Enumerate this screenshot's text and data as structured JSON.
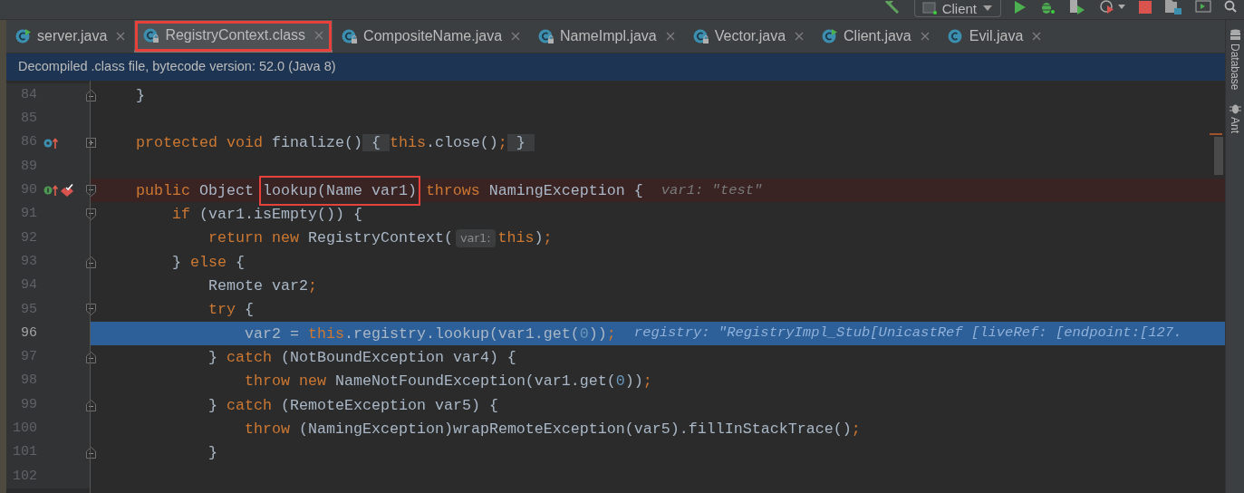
{
  "toolbar": {
    "run_config": "Client"
  },
  "tabs": [
    {
      "label": "server.java",
      "kind": "runnable",
      "selected": false,
      "highlighted": false
    },
    {
      "label": "RegistryContext.class",
      "kind": "library",
      "selected": true,
      "highlighted": true
    },
    {
      "label": "CompositeName.java",
      "kind": "library",
      "selected": false,
      "highlighted": false
    },
    {
      "label": "NameImpl.java",
      "kind": "library",
      "selected": false,
      "highlighted": false
    },
    {
      "label": "Vector.java",
      "kind": "library",
      "selected": false,
      "highlighted": false
    },
    {
      "label": "Client.java",
      "kind": "runnable",
      "selected": false,
      "highlighted": false
    },
    {
      "label": "Evil.java",
      "kind": "source",
      "selected": false,
      "highlighted": false
    }
  ],
  "banner": "Decompiled .class file, bytecode version: 52.0 (Java 8)",
  "lines": [
    {
      "number": "84",
      "folded": false,
      "fold_end": true,
      "breakpoint": false,
      "current": false,
      "segments": [
        {
          "kind": "code",
          "tokens": [
            {
              "kind": "plain",
              "text": "}"
            }
          ]
        }
      ]
    },
    {
      "number": "85",
      "folded": false,
      "fold_end": false,
      "breakpoint": false,
      "current": false
    },
    {
      "number": "86",
      "kind": "overriding",
      "folded": true,
      "fold_end": false,
      "breakpoint": false,
      "current": false,
      "segments": [
        {
          "kind": "code",
          "tokens": [
            {
              "kind": "keyword",
              "text": "protected void "
            },
            {
              "kind": "plain",
              "text": "finalize()"
            },
            {
              "kind": "folded",
              "text": "{"
            },
            {
              "kind": "keyword",
              "text": "this"
            },
            {
              "kind": "plain",
              "text": ".close()"
            },
            {
              "kind": "keyword",
              "text": ";"
            },
            {
              "kind": "folded",
              "text": "}"
            }
          ]
        }
      ]
    },
    {
      "number": "89",
      "folded": false,
      "fold_end": false,
      "breakpoint": false,
      "current": false
    },
    {
      "number": "90",
      "kind": "implementing",
      "folded": false,
      "fold_end": false,
      "breakpoint": true,
      "current": false,
      "segments": [
        {
          "kind": "code",
          "tokens": [
            {
              "kind": "keyword",
              "text": "public "
            },
            {
              "kind": "plain",
              "text": "Object"
            }
          ]
        },
        {
          "kind": "boxed",
          "tokens": [
            {
              "kind": "plain",
              "text": "lookup(Name var1)"
            }
          ]
        },
        {
          "kind": "code",
          "tokens": [
            {
              "kind": "keyword",
              "text": "throws "
            },
            {
              "kind": "plain",
              "text": "NamingException {"
            }
          ]
        },
        {
          "kind": "hint",
          "text": "var1: \"test\""
        }
      ],
      "children": [
        {
          "number": "91",
          "folded": false,
          "fold_end": false,
          "breakpoint": false,
          "current": false,
          "segments": [
            {
              "kind": "code",
              "tokens": [
                {
                  "kind": "keyword",
                  "text": "if "
                },
                {
                  "kind": "plain",
                  "text": "(var1.isEmpty()) {"
                }
              ]
            }
          ],
          "children": [
            {
              "number": "92",
              "folded": false,
              "fold_end": false,
              "breakpoint": false,
              "current": false,
              "segments": [
                {
                  "kind": "code",
                  "tokens": [
                    {
                      "kind": "keyword",
                      "text": "return new "
                    },
                    {
                      "kind": "plain",
                      "text": "RegistryContext("
                    }
                  ]
                },
                {
                  "kind": "inlay",
                  "text": "var1:"
                },
                {
                  "kind": "code",
                  "tokens": [
                    {
                      "kind": "keyword",
                      "text": "this"
                    },
                    {
                      "kind": "plain",
                      "text": ")"
                    },
                    {
                      "kind": "keyword",
                      "text": ";"
                    }
                  ]
                }
              ]
            }
          ]
        },
        {
          "number": "93",
          "folded": false,
          "fold_end": true,
          "breakpoint": false,
          "current": false,
          "segments": [
            {
              "kind": "code",
              "tokens": [
                {
                  "kind": "plain",
                  "text": "} "
                },
                {
                  "kind": "keyword",
                  "text": "else "
                },
                {
                  "kind": "plain",
                  "text": "{"
                }
              ]
            }
          ],
          "children": [
            {
              "number": "94",
              "folded": false,
              "fold_end": false,
              "breakpoint": false,
              "current": false,
              "segments": [
                {
                  "kind": "code",
                  "tokens": [
                    {
                      "kind": "plain",
                      "text": "Remote var2"
                    },
                    {
                      "kind": "keyword",
                      "text": ";"
                    }
                  ]
                }
              ]
            },
            {
              "number": "95",
              "folded": false,
              "fold_end": false,
              "breakpoint": false,
              "current": false,
              "segments": [
                {
                  "kind": "code",
                  "tokens": [
                    {
                      "kind": "keyword",
                      "text": "try "
                    },
                    {
                      "kind": "plain",
                      "text": "{"
                    }
                  ]
                }
              ],
              "children": [
                {
                  "number": "96",
                  "folded": false,
                  "fold_end": false,
                  "breakpoint": false,
                  "current": true,
                  "segments": [
                    {
                      "kind": "code",
                      "tokens": [
                        {
                          "kind": "plain",
                          "text": "var2 = "
                        },
                        {
                          "kind": "keyword",
                          "text": "this"
                        },
                        {
                          "kind": "plain",
                          "text": ".registry.lookup(var1.get("
                        },
                        {
                          "kind": "number",
                          "text": "0"
                        },
                        {
                          "kind": "plain",
                          "text": "))"
                        },
                        {
                          "kind": "keyword",
                          "text": ";"
                        }
                      ]
                    },
                    {
                      "kind": "hint",
                      "text": "registry: \"RegistryImpl_Stub[UnicastRef [liveRef: [endpoint:[127."
                    }
                  ]
                }
              ]
            },
            {
              "number": "97",
              "folded": false,
              "fold_end": true,
              "breakpoint": false,
              "current": false,
              "segments": [
                {
                  "kind": "code",
                  "tokens": [
                    {
                      "kind": "plain",
                      "text": "} "
                    },
                    {
                      "kind": "keyword",
                      "text": "catch "
                    },
                    {
                      "kind": "plain",
                      "text": "(NotBoundException var4) {"
                    }
                  ]
                }
              ],
              "children": [
                {
                  "number": "98",
                  "folded": false,
                  "fold_end": false,
                  "breakpoint": false,
                  "current": false,
                  "segments": [
                    {
                      "kind": "code",
                      "tokens": [
                        {
                          "kind": "keyword",
                          "text": "throw new "
                        },
                        {
                          "kind": "plain",
                          "text": "NameNotFoundException(var1.get("
                        },
                        {
                          "kind": "number",
                          "text": "0"
                        },
                        {
                          "kind": "plain",
                          "text": "))"
                        },
                        {
                          "kind": "keyword",
                          "text": ";"
                        }
                      ]
                    }
                  ]
                }
              ]
            },
            {
              "number": "99",
              "folded": false,
              "fold_end": true,
              "breakpoint": false,
              "current": false,
              "segments": [
                {
                  "kind": "code",
                  "tokens": [
                    {
                      "kind": "plain",
                      "text": "} "
                    },
                    {
                      "kind": "keyword",
                      "text": "catch "
                    },
                    {
                      "kind": "plain",
                      "text": "(RemoteException var5) {"
                    }
                  ]
                }
              ],
              "children": [
                {
                  "number": "100",
                  "folded": false,
                  "fold_end": false,
                  "breakpoint": false,
                  "current": false,
                  "segments": [
                    {
                      "kind": "code",
                      "tokens": [
                        {
                          "kind": "keyword",
                          "text": "throw "
                        },
                        {
                          "kind": "plain",
                          "text": "(NamingException)wrapRemoteException(var5).fillInStackTrace()"
                        },
                        {
                          "kind": "keyword",
                          "text": ";"
                        }
                      ]
                    }
                  ]
                }
              ]
            },
            {
              "number": "101",
              "folded": false,
              "fold_end": true,
              "breakpoint": false,
              "current": false,
              "segments": [
                {
                  "kind": "code",
                  "tokens": [
                    {
                      "kind": "plain",
                      "text": "}"
                    }
                  ]
                }
              ]
            }
          ]
        }
      ]
    },
    {
      "number": "102",
      "folded": false,
      "fold_end": false,
      "breakpoint": false,
      "current": false
    }
  ],
  "side_panels": [
    "Database",
    "Ant"
  ]
}
